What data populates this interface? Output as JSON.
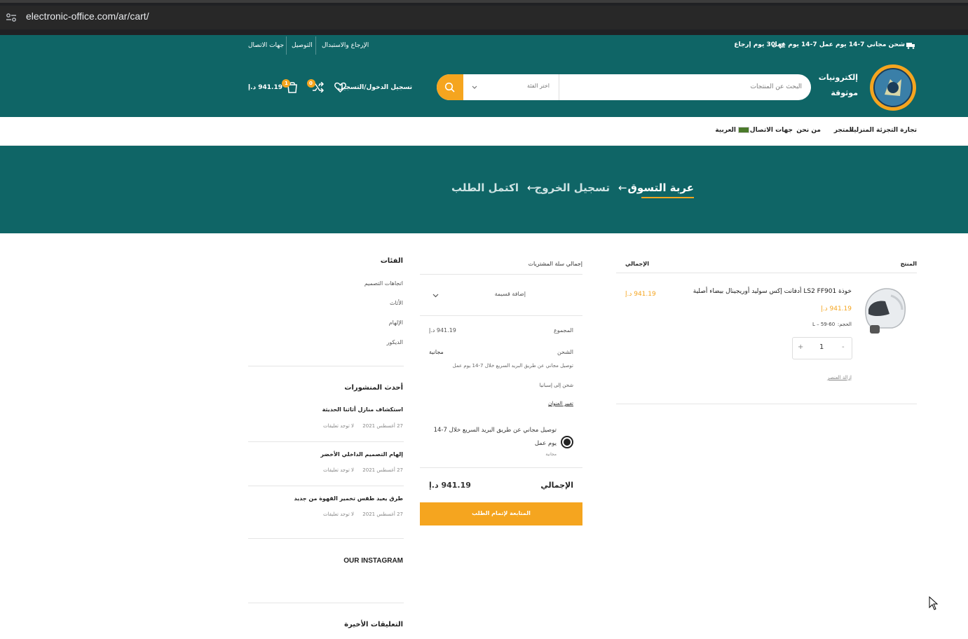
{
  "browser": {
    "url": "electronic-office.com/ar/cart/"
  },
  "topbar": {
    "shipping": "شحن مجاني 7-14 يوم عمل 7-14 يوم عمل",
    "returns": "30 يوم إرجاع",
    "links": [
      "جهات الاتصال",
      "التوصيل",
      "الإرجاع والاستبدال"
    ]
  },
  "header": {
    "brand_line1": "إلكترونيات",
    "brand_line2": "موثوقة",
    "search_placeholder": "البحث عن المنتجات",
    "category_placeholder": "اختر الفئة",
    "login": "تسجيل الدخول/التسجيل",
    "compare_count": "0",
    "cart_count": "1",
    "cart_total": "941.19 د.إ"
  },
  "nav": {
    "items": [
      "تجارة التجزئة المنزلية",
      "المتجر",
      "من نحن",
      "جهات الاتصال",
      "العربية"
    ]
  },
  "hero": {
    "step1": "عربة التسوق",
    "step2": "تسجيل الخروج",
    "step3": "اكتمل الطلب",
    "arrow": "←"
  },
  "cart": {
    "col_product": "المنتج",
    "col_total": "الإجمالي",
    "item": {
      "name": "خوذة LS2 FF901 أدفانت إكس سوليد أوريجينال بيضاء أصلية",
      "price": "941.19 د.إ",
      "size_label": "الحجم:",
      "size_value": "L – 59-60",
      "qty": "1",
      "minus": "-",
      "plus": "+",
      "remove": "إزالة العنصر",
      "line_total": "941.19 د.إ"
    }
  },
  "totals": {
    "heading": "إجمالي سلة المشتريات",
    "coupon": "إضافة قسيمة",
    "subtotal_label": "المجموع",
    "subtotal_value": "941.19 د.إ",
    "shipping_label": "الشحن",
    "shipping_value": "مجانية",
    "shipping_note": "توصيل مجاني عن طريق البريد السريع خلال 7-14 يوم عمل",
    "ship_to": "شحن إلى إسبانيا",
    "change_address": "تغيير العنوان",
    "option_text_1": "توصيل مجاني عن طريق البريد السريع خلال 7-14",
    "option_text_2": "يوم عمل",
    "option_sub": "مجانية",
    "total_label": "الإجمالي",
    "total_value": "941.19 د.إ",
    "checkout": "المتابعة لإتمام الطلب"
  },
  "sidebar": {
    "categories_heading": "الفئات",
    "categories": [
      "اتجاهات التصميم",
      "الأثاث",
      "الإلهام",
      "الديكور"
    ],
    "posts_heading": "أحدث المنشورات",
    "posts": [
      {
        "title": "استكشاف منازل أثاثنا الحديثة",
        "date": "27 أغسطس 2021",
        "comments": "لا توجد تعليقات"
      },
      {
        "title": "إلهام التصميم الداخلي الأخضر",
        "date": "27 أغسطس 2021",
        "comments": "لا توجد تعليقات"
      },
      {
        "title": "طرق يعيد طقس تخمير القهوة من جديد",
        "date": "27 أغسطس 2021",
        "comments": "لا توجد تعليقات"
      }
    ],
    "instagram_heading": "OUR INSTAGRAM",
    "comments_heading": "التعليقات الأخيرة"
  },
  "colors": {
    "teal": "#0f6566",
    "accent": "#f5a51f"
  }
}
